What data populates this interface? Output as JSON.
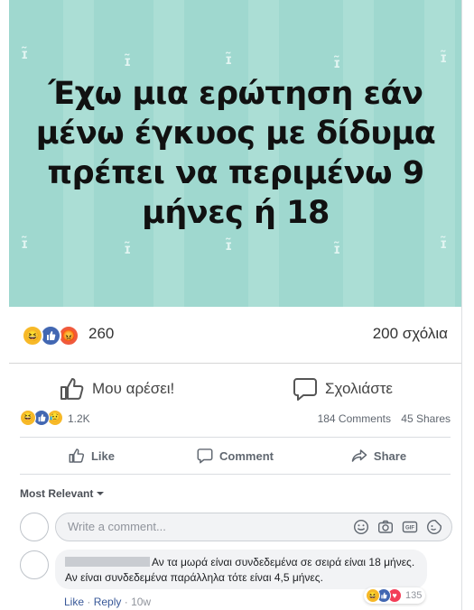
{
  "image_post": {
    "text_lines": [
      "Έχω μια ερώτηση εάν",
      "μένω έγκυος με δίδυμα",
      "πρέπει να περιμένω 9",
      "μήνες ή 18"
    ],
    "reactions_count": "260",
    "comments_label": "200 σχόλια",
    "like_label": "Μου αρέσει!",
    "comment_label": "Σχολιάστε"
  },
  "post": {
    "reactions_count": "1.2K",
    "comments_count": "184 Comments",
    "shares_count": "45 Shares",
    "actions": {
      "like": "Like",
      "comment": "Comment",
      "share": "Share"
    },
    "sort_label": "Most Relevant"
  },
  "composer": {
    "placeholder": "Write a comment..."
  },
  "comment": {
    "text": "Αν τα μωρά είναι συνδεδεμένα σε σειρά είναι 18 μήνες. Αν είναι συνδεδεμένα παράλληλα τότε είναι 4,5 μήνες.",
    "reaction_count": "135",
    "meta": {
      "like": "Like",
      "reply": "Reply",
      "age": "10w"
    }
  },
  "colors": {
    "meme_bg": "#9fd8cf",
    "like_blue": "#4267b2",
    "love_red": "#f33e58",
    "haha_yellow": "#f7b928"
  }
}
